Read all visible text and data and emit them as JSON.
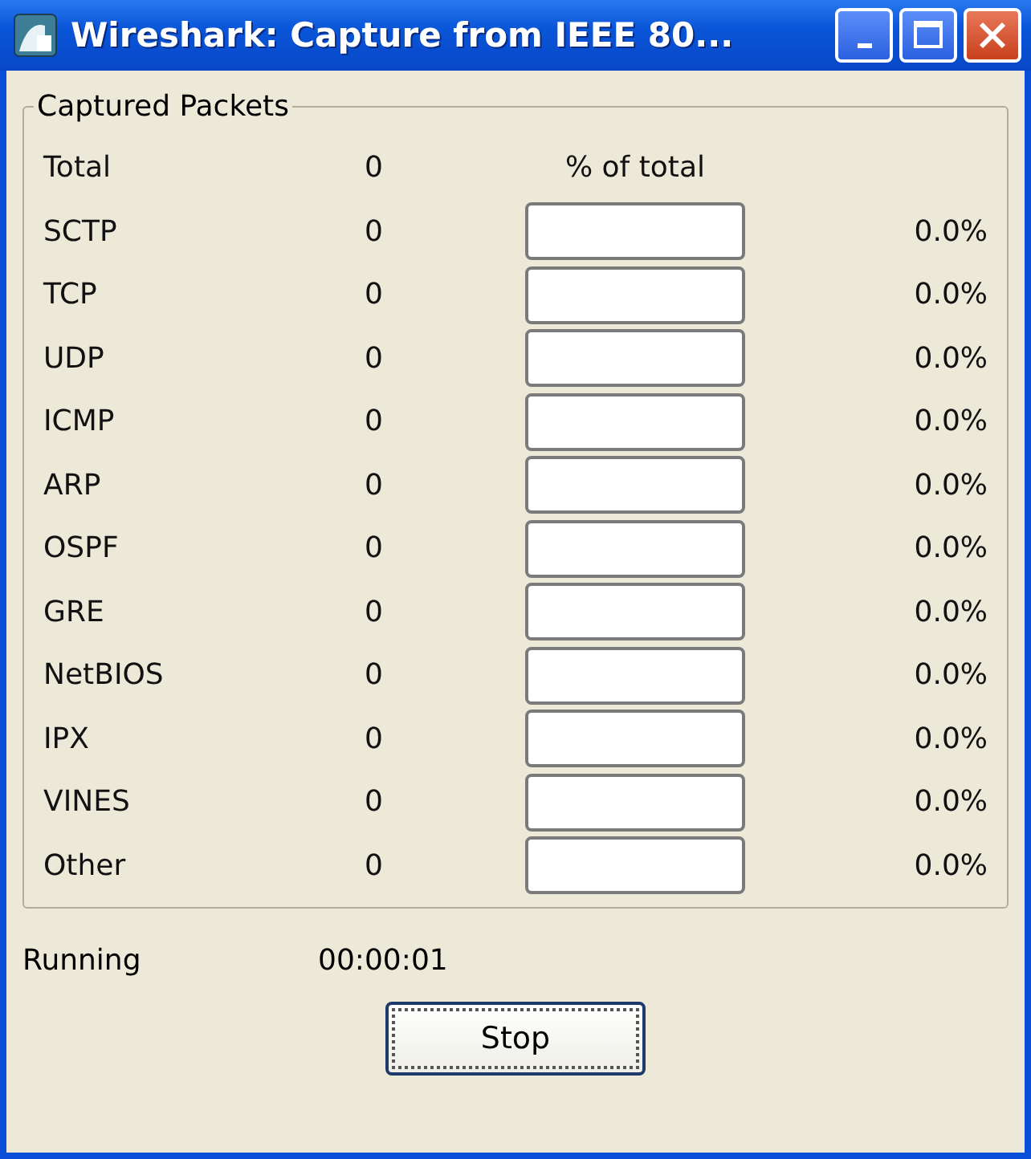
{
  "window": {
    "title": "Wireshark: Capture from IEEE 80..."
  },
  "captured_packets": {
    "title": "Captured Packets",
    "header": {
      "name": "Total",
      "count": "0",
      "percent_heading": "% of total"
    },
    "rows": [
      {
        "name": "SCTP",
        "count": "0",
        "percent": "0.0%"
      },
      {
        "name": "TCP",
        "count": "0",
        "percent": "0.0%"
      },
      {
        "name": "UDP",
        "count": "0",
        "percent": "0.0%"
      },
      {
        "name": "ICMP",
        "count": "0",
        "percent": "0.0%"
      },
      {
        "name": "ARP",
        "count": "0",
        "percent": "0.0%"
      },
      {
        "name": "OSPF",
        "count": "0",
        "percent": "0.0%"
      },
      {
        "name": "GRE",
        "count": "0",
        "percent": "0.0%"
      },
      {
        "name": "NetBIOS",
        "count": "0",
        "percent": "0.0%"
      },
      {
        "name": "IPX",
        "count": "0",
        "percent": "0.0%"
      },
      {
        "name": "VINES",
        "count": "0",
        "percent": "0.0%"
      },
      {
        "name": "Other",
        "count": "0",
        "percent": "0.0%"
      }
    ]
  },
  "status": {
    "label": "Running",
    "elapsed": "00:00:01"
  },
  "buttons": [
    {
      "label": "Stop"
    }
  ]
}
